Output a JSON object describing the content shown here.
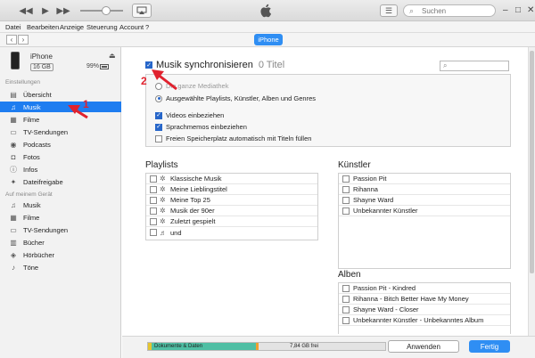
{
  "toolbar": {
    "search_placeholder": "Suchen",
    "icons": {
      "rewind": "rewind-icon",
      "play": "play-icon",
      "forward": "fast-forward-icon",
      "airplay": "airplay-icon",
      "apple": "apple-logo-icon",
      "list": "list-view-icon"
    }
  },
  "menu": [
    "Datei",
    "Bearbeiten",
    "Anzeige",
    "Steuerung",
    "Account",
    "?"
  ],
  "nav": {
    "device_button": "iPhone"
  },
  "device": {
    "name": "iPhone",
    "capacity": "16 GB",
    "battery": "99%"
  },
  "sidebar": {
    "settings_label": "Einstellungen",
    "settings_items": [
      {
        "label": "Übersicht",
        "icon": "summary-icon"
      },
      {
        "label": "Musik",
        "icon": "music-note-icon",
        "selected": true
      },
      {
        "label": "Filme",
        "icon": "film-icon"
      },
      {
        "label": "TV-Sendungen",
        "icon": "tv-icon"
      },
      {
        "label": "Podcasts",
        "icon": "podcast-icon"
      },
      {
        "label": "Fotos",
        "icon": "camera-icon"
      },
      {
        "label": "Infos",
        "icon": "info-icon"
      },
      {
        "label": "Dateifreigabe",
        "icon": "apps-icon"
      }
    ],
    "ondevice_label": "Auf meinem Gerät",
    "ondevice_items": [
      {
        "label": "Musik",
        "icon": "music-note-icon"
      },
      {
        "label": "Filme",
        "icon": "film-icon"
      },
      {
        "label": "TV-Sendungen",
        "icon": "tv-icon"
      },
      {
        "label": "Bücher",
        "icon": "book-icon"
      },
      {
        "label": "Hörbücher",
        "icon": "audiobook-icon"
      },
      {
        "label": "Töne",
        "icon": "bell-icon"
      }
    ]
  },
  "sync": {
    "title": "Musik synchronisieren",
    "count": "0 Titel",
    "checked": true,
    "options": {
      "entire_library": "Die ganze Mediathek",
      "selected": "Ausgewählte Playlists, Künstler, Alben und Genres",
      "videos": "Videos einbeziehen",
      "voice_memos": "Sprachmemos einbeziehen",
      "fill_space": "Freien Speicherplatz automatisch mit Titeln füllen"
    }
  },
  "playlists": {
    "title": "Playlists",
    "items": [
      "Klassische Musik",
      "Meine Lieblingstitel",
      "Meine Top 25",
      "Musik der 90er",
      "Zuletzt gespielt",
      "und"
    ]
  },
  "artists": {
    "title": "Künstler",
    "items": [
      "Passion Pit",
      "Rihanna",
      "Shayne Ward",
      "Unbekannter Künstler"
    ]
  },
  "albums": {
    "title": "Alben",
    "items": [
      "Passion Pit - Kindred",
      "Rihanna - Bitch Better Have My Money",
      "Shayne Ward - Closer",
      "Unbekannter Künstler - Unbekanntes Album"
    ]
  },
  "storage": {
    "documents_label": "Dokumente & Daten",
    "free_label": "7,84 GB frei",
    "colors": {
      "apps": "#e5c52f",
      "documents": "#4fbfa4",
      "audio": "#f0a030",
      "free": "#e3e3e3"
    },
    "documents_fraction": 0.44
  },
  "buttons": {
    "apply": "Anwenden",
    "done": "Fertig"
  },
  "annotations": {
    "one": "1",
    "two": "2"
  }
}
